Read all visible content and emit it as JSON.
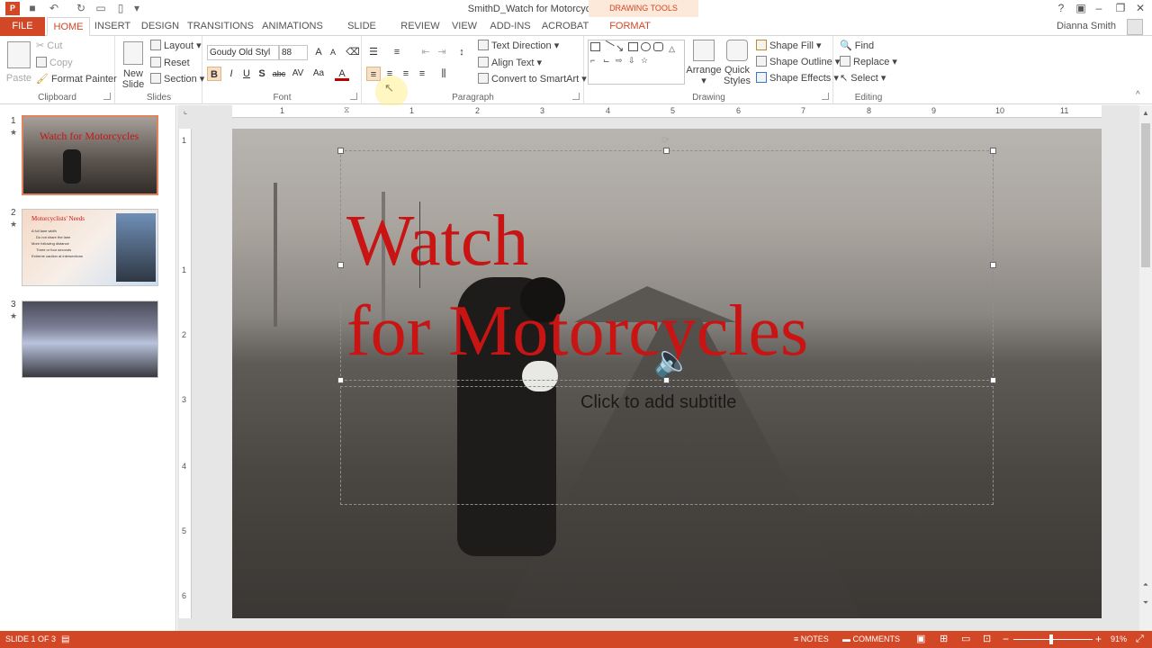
{
  "titlebar": {
    "document_title": "SmithD_Watch for Motorcycles.pptx - PowerPoint",
    "contextual_group": "DRAWING TOOLS",
    "help": "?"
  },
  "tabs": {
    "file": "FILE",
    "items": [
      "HOME",
      "INSERT",
      "DESIGN",
      "TRANSITIONS",
      "ANIMATIONS",
      "SLIDE SHOW",
      "REVIEW",
      "VIEW",
      "ADD-INS",
      "ACROBAT",
      "FORMAT"
    ],
    "active": "HOME",
    "user": "Dianna Smith"
  },
  "ribbon": {
    "clipboard": {
      "label": "Clipboard",
      "paste": "Paste",
      "cut": "Cut",
      "copy": "Copy",
      "format_painter": "Format Painter"
    },
    "slides": {
      "label": "Slides",
      "new_slide_line1": "New",
      "new_slide_line2": "Slide",
      "layout": "Layout",
      "reset": "Reset",
      "section": "Section"
    },
    "font": {
      "label": "Font",
      "font_name": "Goudy Old Styl",
      "font_size": "88",
      "bold": "B",
      "italic": "I",
      "underline": "U",
      "shadow": "S",
      "strike": "abc",
      "spacing": "AV",
      "case": "Aa",
      "color": "A",
      "grow": "A",
      "shrink": "A"
    },
    "paragraph": {
      "label": "Paragraph",
      "text_direction": "Text Direction",
      "align_text": "Align Text",
      "convert_smartart": "Convert to SmartArt"
    },
    "drawing": {
      "label": "Drawing",
      "arrange": "Arrange",
      "quick_styles_line1": "Quick",
      "quick_styles_line2": "Styles",
      "shape_fill": "Shape Fill",
      "shape_outline": "Shape Outline",
      "shape_effects": "Shape Effects"
    },
    "editing": {
      "label": "Editing",
      "find": "Find",
      "replace": "Replace",
      "select": "Select"
    }
  },
  "thumbnails": [
    {
      "num": "1",
      "star": "★",
      "title": "Watch for Motorcycles"
    },
    {
      "num": "2",
      "star": "★",
      "title": "Motorcyclists' Needs",
      "bullets": [
        "A full lane width",
        "Do not share the lane",
        "More following distance",
        "Three or four seconds",
        "Extreme caution at intersections"
      ]
    },
    {
      "num": "3",
      "star": "★"
    }
  ],
  "ruler": {
    "h": [
      "1",
      "1",
      "2",
      "3",
      "4",
      "5",
      "6",
      "7",
      "8",
      "9",
      "10",
      "11"
    ],
    "v": [
      "1",
      "1",
      "2",
      "3",
      "4",
      "5",
      "6"
    ]
  },
  "slide": {
    "title_line1": "Watch",
    "title_line2": "for Motorcycles",
    "subtitle_placeholder": "Click to add subtitle"
  },
  "status": {
    "slide_info": "SLIDE 1 OF 3",
    "notes": "NOTES",
    "comments": "COMMENTS",
    "zoom": "91%"
  },
  "colors": {
    "accent": "#d24726",
    "title_red": "#c91414"
  }
}
